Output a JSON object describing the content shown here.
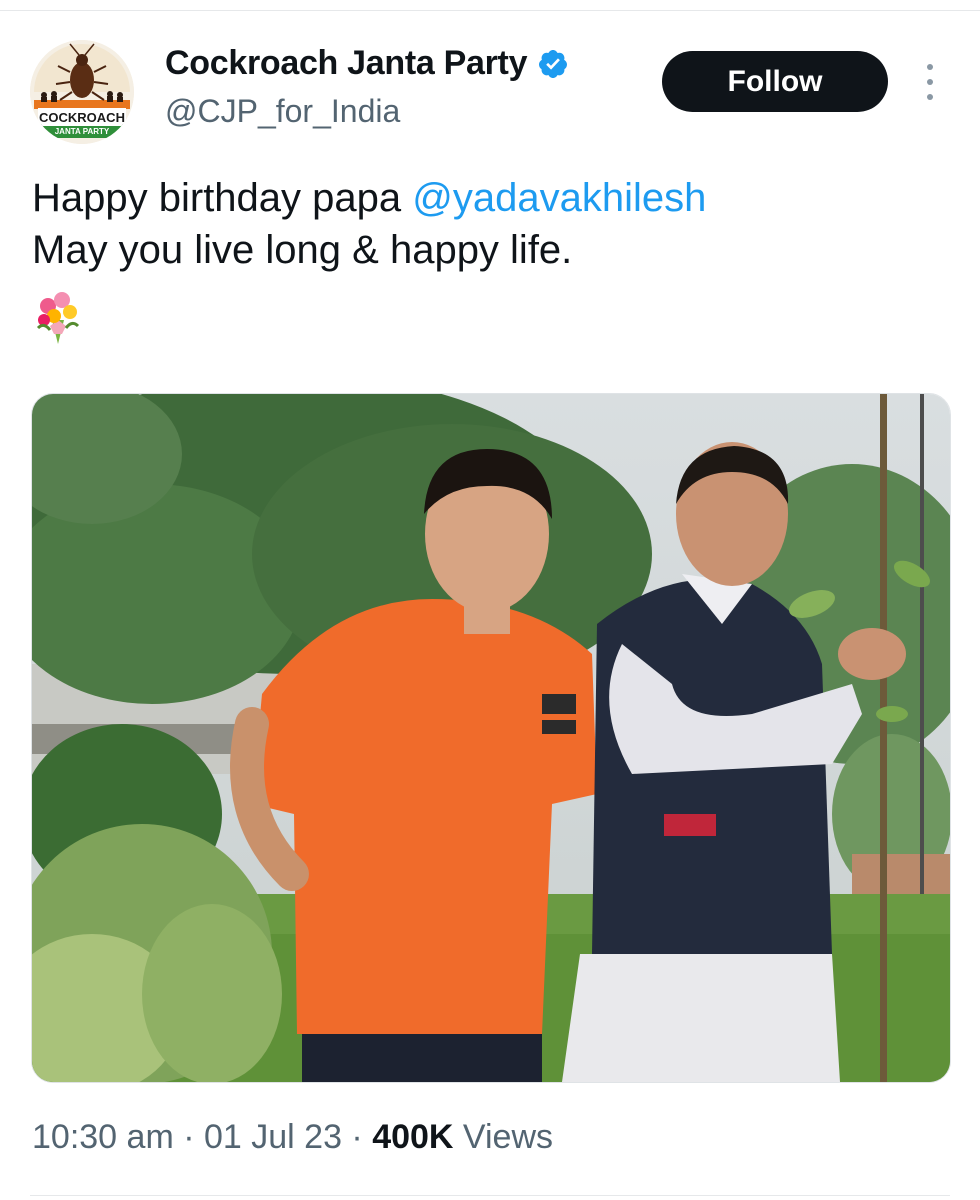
{
  "author": {
    "display_name": "Cockroach Janta Party",
    "handle": "@CJP_for_India",
    "verified": true,
    "avatar_text_main": "COCKROACH",
    "avatar_text_sub": "JANTA PARTY"
  },
  "follow_label": "Follow",
  "tweet": {
    "text_line1_prefix": "Happy birthday papa ",
    "mention": "@yadavakhilesh",
    "text_line2": "May you live long & happy life.",
    "emoji": "💐"
  },
  "meta": {
    "time": "10:30 am",
    "sep1": " · ",
    "date": "01 Jul 23",
    "sep2": " · ",
    "views_count": "400K",
    "views_label": " Views"
  },
  "colors": {
    "mention": "#1d9bf0",
    "verified_badge": "#1d9bf0",
    "follow_bg": "#0f1419",
    "secondary_text": "#536471"
  },
  "icons": {
    "verified": "verified-badge-icon",
    "more": "more-vertical-icon",
    "emoji": "bouquet-emoji-icon"
  }
}
